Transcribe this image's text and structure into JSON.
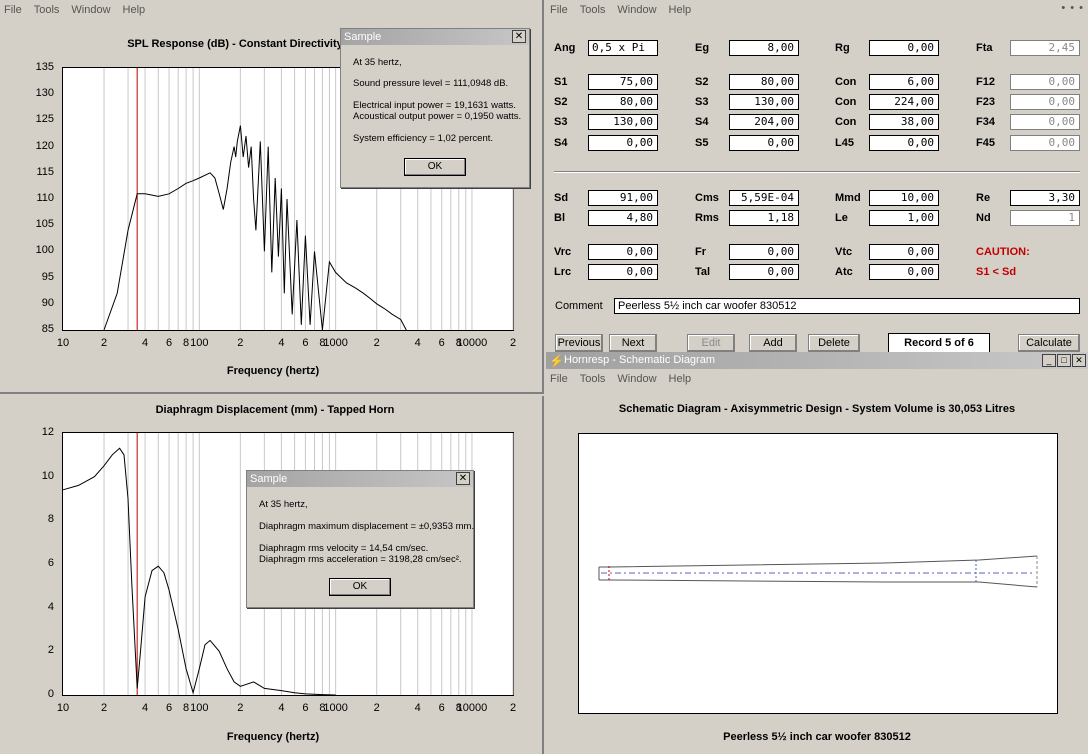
{
  "menu": {
    "file": "File",
    "tools": "Tools",
    "window": "Window",
    "help": "Help"
  },
  "spl": {
    "title": "SPL Response (dB) - Constant Directivity",
    "y_ticks": [
      "135",
      "130",
      "125",
      "120",
      "115",
      "110",
      "105",
      "100",
      "95",
      "90",
      "85"
    ],
    "x_ticks": [
      "10",
      "2",
      "4",
      "6",
      "8",
      "100",
      "2",
      "4",
      "6",
      "8",
      "1000",
      "2",
      "4",
      "6",
      "8",
      "10000",
      "2"
    ],
    "xlabel": "Frequency (hertz)"
  },
  "disp": {
    "title": "Diaphragm Displacement (mm) - Tapped Horn",
    "y_ticks": [
      "12",
      "10",
      "8",
      "6",
      "4",
      "2",
      "0"
    ],
    "x_ticks": [
      "10",
      "2",
      "4",
      "6",
      "8",
      "100",
      "2",
      "4",
      "6",
      "8",
      "1000",
      "2",
      "4",
      "6",
      "8",
      "10000",
      "2"
    ],
    "xlabel": "Frequency (hertz)"
  },
  "chart_data": [
    {
      "type": "line",
      "title": "SPL Response (dB) - Constant Directivity",
      "xlabel": "Frequency (hertz)",
      "ylabel": "",
      "x_scale": "log",
      "xlim": [
        10,
        20000
      ],
      "ylim": [
        85,
        135
      ],
      "grid": true,
      "marker_x": 35,
      "x": [
        20,
        25,
        30,
        35,
        40,
        50,
        60,
        70,
        80,
        90,
        100,
        120,
        130,
        140,
        150,
        160,
        170,
        180,
        185,
        190,
        200,
        210,
        220,
        230,
        240,
        250,
        260,
        280,
        300,
        320,
        340,
        360,
        380,
        400,
        420,
        440,
        480,
        520,
        560,
        600,
        650,
        700,
        800,
        900,
        1000,
        1200,
        1400,
        1600,
        1800,
        2000,
        2300,
        2600,
        3000,
        3300
      ],
      "y": [
        85,
        92,
        104,
        111,
        111,
        110.5,
        111,
        112,
        113,
        113.5,
        114,
        115,
        114,
        111,
        108,
        112,
        117,
        120,
        118,
        121,
        124,
        118,
        122,
        116,
        120,
        110,
        104,
        121,
        100,
        120,
        96,
        114,
        99,
        112,
        92,
        110,
        88,
        106,
        86,
        103,
        86,
        100,
        85,
        98,
        96,
        94,
        93,
        92,
        91,
        90,
        89,
        88,
        87,
        85
      ]
    },
    {
      "type": "line",
      "title": "Diaphragm Displacement (mm) - Tapped Horn",
      "xlabel": "Frequency (hertz)",
      "ylabel": "",
      "x_scale": "log",
      "xlim": [
        10,
        20000
      ],
      "ylim": [
        0,
        12
      ],
      "grid": true,
      "marker_x": 35,
      "x": [
        10,
        13,
        17,
        20,
        23,
        26,
        28,
        30,
        32,
        35,
        37,
        40,
        45,
        50,
        55,
        60,
        70,
        80,
        90,
        100,
        110,
        120,
        140,
        160,
        180,
        200,
        250,
        300,
        400,
        500,
        600,
        800,
        1000
      ],
      "y": [
        9.4,
        9.6,
        10,
        10.5,
        11,
        11.3,
        11,
        9,
        5,
        0.3,
        2,
        4.5,
        5.7,
        5.9,
        5.6,
        4.8,
        3,
        1.2,
        0.1,
        1.2,
        2.3,
        2.5,
        2,
        1.2,
        0.6,
        0.4,
        0.6,
        0.3,
        0.2,
        0.1,
        0.05,
        0.02,
        0
      ]
    }
  ],
  "dlg1": {
    "title": "Sample",
    "lines": [
      "At 35 hertz,",
      "Sound pressure level = 111,0948 dB.",
      "Electrical input power = 19,1631 watts.",
      "Acoustical output power = 0,1950 watts.",
      "System efficiency = 1,02 percent."
    ],
    "ok": "OK"
  },
  "dlg2": {
    "title": "Sample",
    "lines": [
      "At 35 hertz,",
      "Diaphragm maximum displacement = ±0,9353 mm.",
      "Diaphragm rms velocity = 14,54 cm/sec.",
      "Diaphragm rms acceleration = 3198,28 cm/sec²."
    ],
    "ok": "OK"
  },
  "params": {
    "ang": "Ang",
    "ang_v": "0,5 x Pi",
    "eg": "Eg",
    "eg_v": "8,00",
    "rg": "Rg",
    "rg_v": "0,00",
    "fta": "Fta",
    "fta_v": "2,45",
    "s1": "S1",
    "s1_v": "75,00",
    "s2a": "S2",
    "s2a_v": "80,00",
    "con1": "Con",
    "con1_v": "6,00",
    "f12": "F12",
    "f12_v": "0,00",
    "s2b": "S2",
    "s2b_v": "80,00",
    "s3a": "S3",
    "s3a_v": "130,00",
    "con2": "Con",
    "con2_v": "224,00",
    "f23": "F23",
    "f23_v": "0,00",
    "s3b": "S3",
    "s3b_v": "130,00",
    "s4a": "S4",
    "s4a_v": "204,00",
    "con3": "Con",
    "con3_v": "38,00",
    "f34": "F34",
    "f34_v": "0,00",
    "s4b": "S4",
    "s4b_v": "0,00",
    "s5": "S5",
    "s5_v": "0,00",
    "l45": "L45",
    "l45_v": "0,00",
    "f45": "F45",
    "f45_v": "0,00",
    "sd": "Sd",
    "sd_v": "91,00",
    "cms": "Cms",
    "cms_v": "5,59E-04",
    "mmd": "Mmd",
    "mmd_v": "10,00",
    "re": "Re",
    "re_v": "3,30",
    "bl": "Bl",
    "bl_v": "4,80",
    "rms": "Rms",
    "rms_v": "1,18",
    "le": "Le",
    "le_v": "1,00",
    "nd": "Nd",
    "nd_v": "1",
    "vrc": "Vrc",
    "vrc_v": "0,00",
    "fr": "Fr",
    "fr_v": "0,00",
    "vtc": "Vtc",
    "vtc_v": "0,00",
    "lrc": "Lrc",
    "lrc_v": "0,00",
    "tal": "Tal",
    "tal_v": "0,00",
    "atc": "Atc",
    "atc_v": "0,00",
    "caution": "CAUTION:",
    "caution_msg": "S1 < Sd",
    "comment": "Comment",
    "comment_v": "Peerless 5½ inch car woofer 830512"
  },
  "buttons": {
    "previous": "Previous",
    "next": "Next",
    "edit": "Edit",
    "add": "Add",
    "delete": "Delete",
    "record": "Record 5 of 6",
    "calculate": "Calculate"
  },
  "schematic": {
    "window_title": "Hornresp - Schematic Diagram",
    "title": "Schematic Diagram - Axisymmetric Design - System Volume is 30,053 Litres",
    "footer": "Peerless 5½ inch car woofer 830512"
  }
}
